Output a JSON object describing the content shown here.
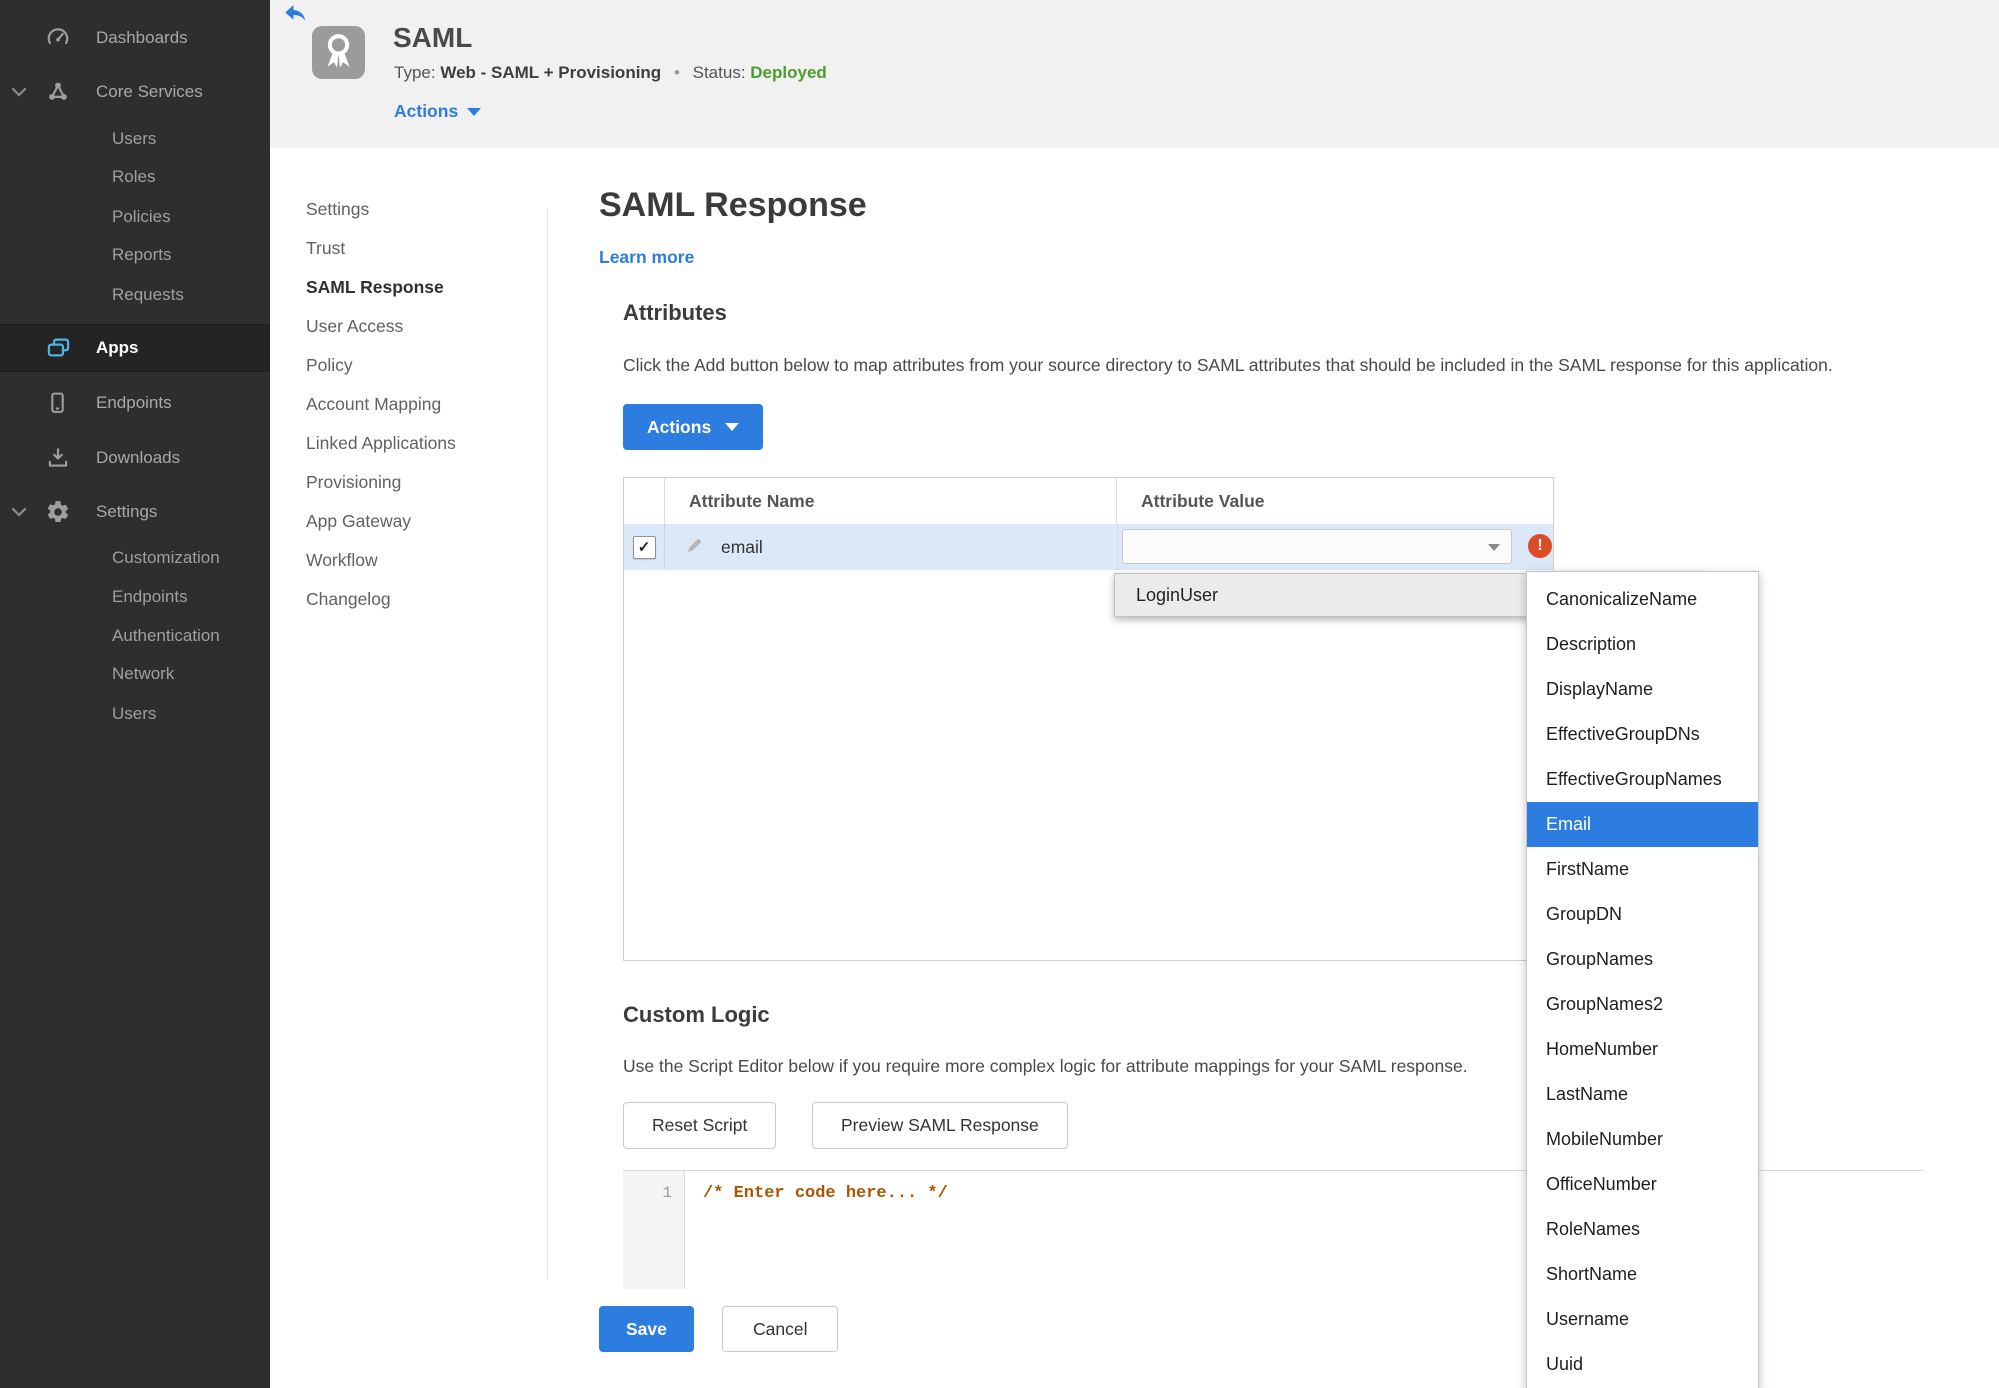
{
  "colors": {
    "accent": "#2d7de0",
    "status_green": "#4c9c2e",
    "error_red": "#dc4b27",
    "row_highlight": "#dbe8f8",
    "comment_orange": "#aa5500",
    "sidebar_bg": "#2e2e2e"
  },
  "sidebar": {
    "items": [
      {
        "label": "Dashboards"
      },
      {
        "label": "Core Services"
      },
      {
        "label": "Users"
      },
      {
        "label": "Roles"
      },
      {
        "label": "Policies"
      },
      {
        "label": "Reports"
      },
      {
        "label": "Requests"
      },
      {
        "label": "Apps"
      },
      {
        "label": "Endpoints"
      },
      {
        "label": "Downloads"
      },
      {
        "label": "Settings"
      },
      {
        "label": "Customization"
      },
      {
        "label": "Endpoints"
      },
      {
        "label": "Authentication"
      },
      {
        "label": "Network"
      },
      {
        "label": "Users"
      }
    ]
  },
  "header": {
    "title": "SAML",
    "type_label": "Type:",
    "type_value": "Web - SAML + Provisioning",
    "separator": "•",
    "status_label": "Status:",
    "status_value": "Deployed",
    "actions_label": "Actions"
  },
  "subnav": {
    "items": [
      "Settings",
      "Trust",
      "SAML Response",
      "User Access",
      "Policy",
      "Account Mapping",
      "Linked Applications",
      "Provisioning",
      "App Gateway",
      "Workflow",
      "Changelog"
    ],
    "active": "SAML Response"
  },
  "main": {
    "title": "SAML Response",
    "learn_more": "Learn more",
    "attributes": {
      "heading": "Attributes",
      "description": "Click the Add button below to map attributes from your source directory to SAML attributes that should be included in the SAML response for this application.",
      "actions_button": "Actions",
      "columns": [
        "Attribute Name",
        "Attribute Value"
      ],
      "rows": [
        {
          "name": "email",
          "value": "",
          "checked": "✓",
          "error": "!"
        }
      ]
    },
    "value_menu": {
      "parent": "LoginUser",
      "items": [
        "CanonicalizeName",
        "Description",
        "DisplayName",
        "EffectiveGroupDNs",
        "EffectiveGroupNames",
        "Email",
        "FirstName",
        "GroupDN",
        "GroupNames",
        "GroupNames2",
        "HomeNumber",
        "LastName",
        "MobileNumber",
        "OfficeNumber",
        "RoleNames",
        "ShortName",
        "Username",
        "Uuid"
      ],
      "selected": "Email"
    },
    "custom_logic": {
      "heading": "Custom Logic",
      "description": "Use the Script Editor below if you require more complex logic for attribute mappings for your SAML response.",
      "reset_button": "Reset Script",
      "preview_button": "Preview SAML Response",
      "line_number": "1",
      "code": "/* Enter code here... */"
    },
    "footer": {
      "save": "Save",
      "cancel": "Cancel"
    }
  }
}
